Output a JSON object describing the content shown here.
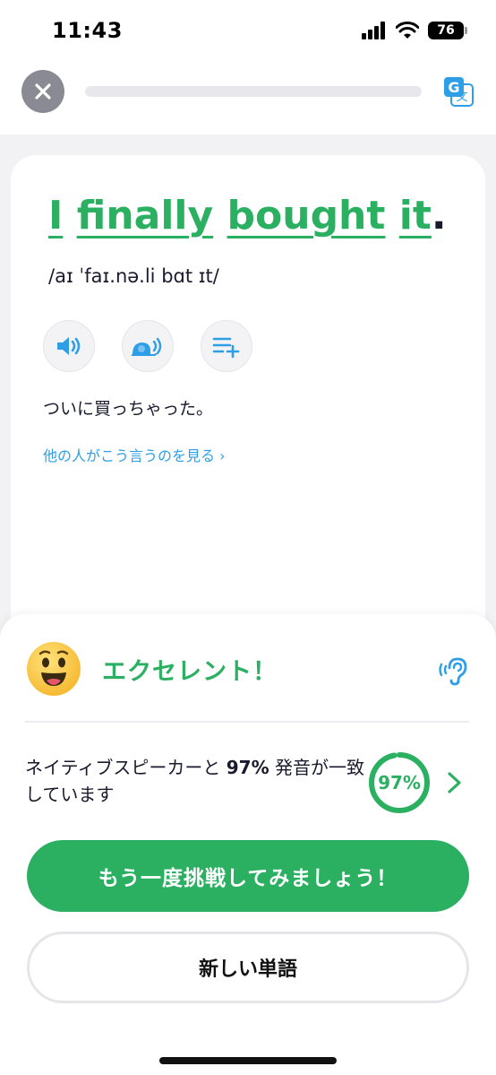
{
  "status_bar": {
    "time": "11:43",
    "battery": "76",
    "icons": [
      "signal-icon",
      "wifi-icon",
      "battery-icon"
    ]
  },
  "top_bar": {
    "close_icon": "close-icon",
    "translate_icon": "translate-icon",
    "progress_fraction": 0.0
  },
  "phrase": {
    "words": [
      "I",
      "finally",
      "bought",
      "it"
    ],
    "period": ".",
    "ipa": "aɪ ˈfaɪ.nə.li bɑt ɪt",
    "translation": "ついに買っちゃった。",
    "see_others_link": "他の人がこう言うのを見る",
    "actions": [
      "speaker-icon",
      "slow-speaker-icon",
      "add-to-list-icon"
    ]
  },
  "result": {
    "title": "エクセレント！",
    "score_text_before": "ネイティブスピーカーと ",
    "score_percent": "97%",
    "score_text_after": " 発音が一致しています",
    "score_value": 0.97,
    "ring_label": "97%",
    "primary_button": "もう一度挑戦してみましょう！",
    "secondary_button": "新しい単語"
  },
  "colors": {
    "accent_green": "#2bb062",
    "link_blue": "#2e9fe6",
    "text_dark": "#1a1a2e"
  }
}
